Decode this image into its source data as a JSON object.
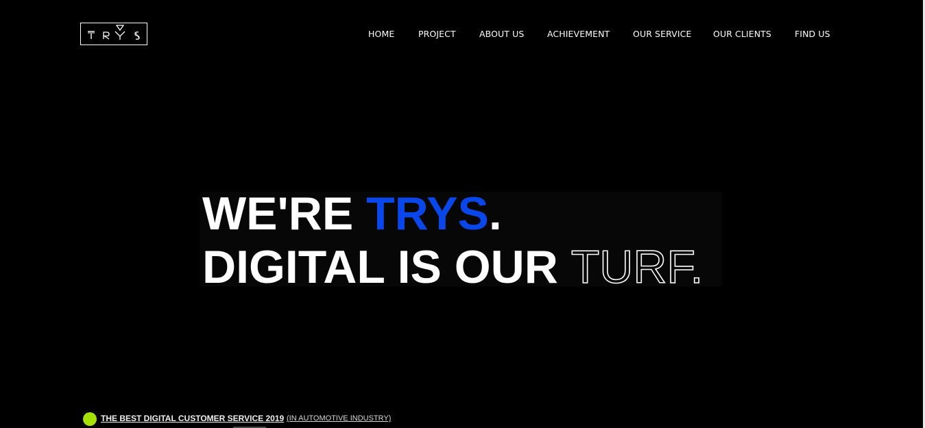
{
  "logo": {
    "text": "TRYS",
    "icon": "trys-logo"
  },
  "nav": {
    "items": [
      {
        "label": "HOME"
      },
      {
        "label": "PROJECT"
      },
      {
        "label": "ABOUT US"
      },
      {
        "label": "ACHIEVEMENT"
      },
      {
        "label": "OUR SERVICE"
      },
      {
        "label": "OUR CLIENTS"
      },
      {
        "label": "FIND US"
      }
    ]
  },
  "hero": {
    "line1_prefix": "WE'RE ",
    "line1_brand": "TRYS",
    "line1_suffix": ".",
    "line2_prefix": "DIGITAL IS OUR ",
    "line2_outline": "TURF."
  },
  "award": {
    "title": "THE BEST DIGITAL CUSTOMER SERVICE 2019",
    "subtitle": "(IN AUTOMOTIVE INDUSTRY)"
  },
  "colors": {
    "background": "#000000",
    "brand_blue": "#0a47ea",
    "award_dot": "#a5e000",
    "text": "#ffffff"
  }
}
